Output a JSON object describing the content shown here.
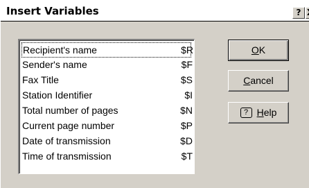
{
  "window": {
    "title": "Insert Variables",
    "help_glyph": "?",
    "close_glyph": "X"
  },
  "variables": [
    {
      "name": "Recipient's name",
      "code": "$R",
      "selected": true
    },
    {
      "name": "Sender's name",
      "code": "$F"
    },
    {
      "name": "Fax Title",
      "code": "$S"
    },
    {
      "name": "Station Identifier",
      "code": "$I"
    },
    {
      "name": "Total number of pages",
      "code": "$N"
    },
    {
      "name": "Current page number",
      "code": "$P"
    },
    {
      "name": "Date of transmission",
      "code": "$D"
    },
    {
      "name": "Time of transmission",
      "code": "$T"
    }
  ],
  "buttons": {
    "ok": {
      "mnemonic": "O",
      "rest": "K"
    },
    "cancel": {
      "mnemonic": "C",
      "rest": "ancel"
    },
    "help": {
      "icon": "help-icon",
      "glyph": "?",
      "mnemonic": "H",
      "rest": "elp"
    }
  }
}
